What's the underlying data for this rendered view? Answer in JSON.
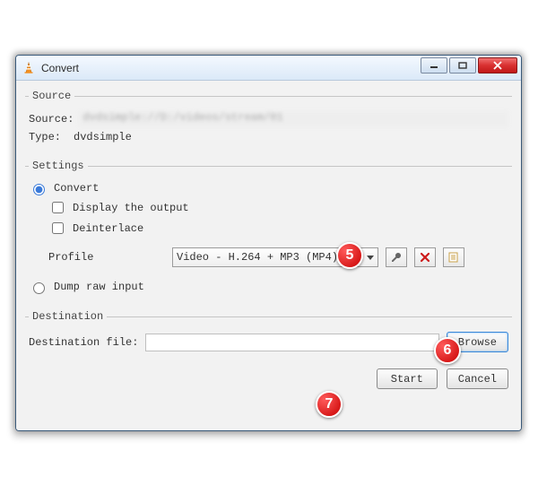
{
  "window": {
    "title": "Convert"
  },
  "source": {
    "legend": "Source",
    "label": "Source:",
    "value_blurred": "dvdsimple://D:/videos/stream/01",
    "type_label": "Type:",
    "type_value": "dvdsimple"
  },
  "settings": {
    "legend": "Settings",
    "convert_label": "Convert",
    "display_output_label": "Display the output",
    "deinterlace_label": "Deinterlace",
    "profile_label": "Profile",
    "profile_selected": "Video - H.264 + MP3 (MP4)",
    "dump_raw_label": "Dump raw input"
  },
  "destination": {
    "legend": "Destination",
    "label": "Destination file:",
    "value": "",
    "browse_label": "Browse"
  },
  "footer": {
    "start_label": "Start",
    "cancel_label": "Cancel"
  },
  "icons": {
    "wrench": "wrench-icon",
    "delete": "delete-icon",
    "new_profile": "new-profile-icon"
  },
  "annotations": {
    "b5": "5",
    "b6": "6",
    "b7": "7"
  }
}
